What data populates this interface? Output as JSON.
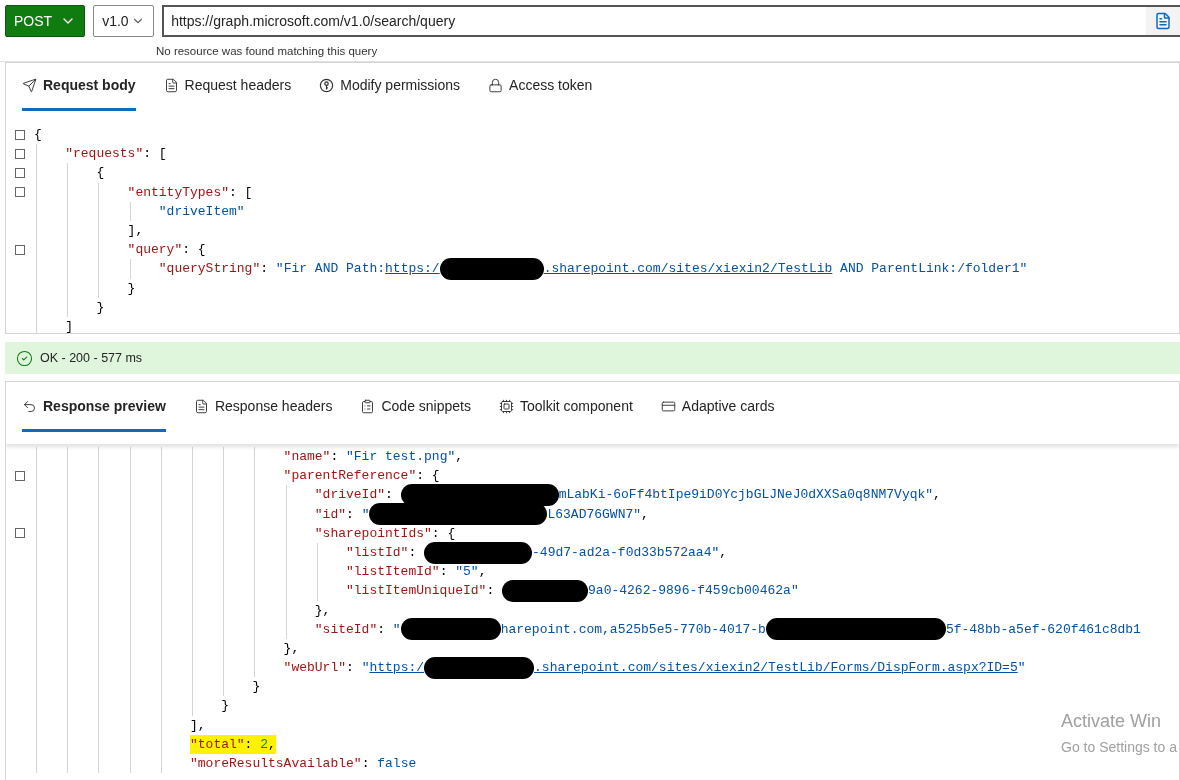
{
  "toolbar": {
    "method": "POST",
    "version": "v1.0",
    "url": "https://graph.microsoft.com/v1.0/search/query",
    "url_hint": "No resource was found matching this query"
  },
  "request_tabs": [
    {
      "label": "Request body",
      "selected": true
    },
    {
      "label": "Request headers",
      "selected": false
    },
    {
      "label": "Modify permissions",
      "selected": false
    },
    {
      "label": "Access token",
      "selected": false
    }
  ],
  "request_body": [
    {
      "foldable": true,
      "tokens": [
        {
          "kind": "punct",
          "text": "{"
        }
      ]
    },
    {
      "foldable": true,
      "tokens": [
        {
          "kind": "key",
          "text": "\"requests\""
        },
        {
          "kind": "punct",
          "text": ": ["
        }
      ]
    },
    {
      "foldable": true,
      "tokens": [
        {
          "kind": "punct",
          "text": "{"
        }
      ]
    },
    {
      "foldable": true,
      "tokens": [
        {
          "kind": "key",
          "text": "\"entityTypes\""
        },
        {
          "kind": "punct",
          "text": ": ["
        }
      ]
    },
    {
      "foldable": false,
      "tokens": [
        {
          "kind": "string",
          "text": "\"driveItem\""
        }
      ]
    },
    {
      "foldable": false,
      "tokens": [
        {
          "kind": "punct",
          "text": "],"
        }
      ]
    },
    {
      "foldable": true,
      "tokens": [
        {
          "kind": "key",
          "text": "\"query\""
        },
        {
          "kind": "punct",
          "text": ": {"
        }
      ]
    },
    {
      "foldable": false,
      "tokens": [
        {
          "kind": "key",
          "text": "\"queryString\""
        },
        {
          "kind": "punct",
          "text": ": "
        },
        {
          "kind": "string",
          "text": "\"Fir AND Path:"
        },
        {
          "kind": "link",
          "text": "https:/"
        },
        {
          "kind": "redaction"
        },
        {
          "kind": "link",
          "text": ".sharepoint.com/sites/xiexin2/TestLib"
        },
        {
          "kind": "string",
          "text": " AND ParentLink:/folder1\""
        }
      ]
    },
    {
      "foldable": false,
      "tokens": [
        {
          "kind": "punct",
          "text": "}"
        }
      ]
    },
    {
      "foldable": false,
      "tokens": [
        {
          "kind": "punct",
          "text": "}"
        }
      ]
    },
    {
      "foldable": false,
      "tokens": [
        {
          "kind": "punct",
          "text": "]"
        }
      ]
    }
  ],
  "status": {
    "text": "OK - 200 - 577 ms"
  },
  "response_tabs": [
    {
      "label": "Response preview",
      "selected": true
    },
    {
      "label": "Response headers",
      "selected": false
    },
    {
      "label": "Code snippets",
      "selected": false
    },
    {
      "label": "Toolkit component",
      "selected": false
    },
    {
      "label": "Adaptive cards",
      "selected": false
    }
  ],
  "response_body": [
    {
      "foldable": false,
      "highlighted": false,
      "tokens": [
        {
          "kind": "key",
          "text": "\"name\""
        },
        {
          "kind": "punct",
          "text": ": "
        },
        {
          "kind": "string",
          "text": "\"Fir test.png\""
        },
        {
          "kind": "punct",
          "text": ","
        }
      ]
    },
    {
      "foldable": true,
      "highlighted": false,
      "tokens": [
        {
          "kind": "key",
          "text": "\"parentReference\""
        },
        {
          "kind": "punct",
          "text": ": {"
        }
      ]
    },
    {
      "foldable": false,
      "highlighted": false,
      "tokens": [
        {
          "kind": "key",
          "text": "\"driveId\""
        },
        {
          "kind": "punct",
          "text": ": "
        },
        {
          "kind": "redaction"
        },
        {
          "kind": "string",
          "text": "mLabKi-6oFf4btIpe9iD0YcjbGLJNeJ0dXXSa0q8NM7Vyqk\""
        },
        {
          "kind": "punct",
          "text": ","
        }
      ]
    },
    {
      "foldable": false,
      "highlighted": false,
      "tokens": [
        {
          "kind": "key",
          "text": "\"id\""
        },
        {
          "kind": "punct",
          "text": ": "
        },
        {
          "kind": "string",
          "text": "\""
        },
        {
          "kind": "redaction"
        },
        {
          "kind": "string",
          "text": "L63AD76GWN7\""
        },
        {
          "kind": "punct",
          "text": ","
        }
      ]
    },
    {
      "foldable": true,
      "highlighted": false,
      "tokens": [
        {
          "kind": "key",
          "text": "\"sharepointIds\""
        },
        {
          "kind": "punct",
          "text": ": {"
        }
      ]
    },
    {
      "foldable": false,
      "highlighted": false,
      "tokens": [
        {
          "kind": "key",
          "text": "\"listId\""
        },
        {
          "kind": "punct",
          "text": ": "
        },
        {
          "kind": "redaction"
        },
        {
          "kind": "string",
          "text": "-49d7-ad2a-f0d33b572aa4\""
        },
        {
          "kind": "punct",
          "text": ","
        }
      ]
    },
    {
      "foldable": false,
      "highlighted": false,
      "tokens": [
        {
          "kind": "key",
          "text": "\"listItemId\""
        },
        {
          "kind": "punct",
          "text": ": "
        },
        {
          "kind": "string",
          "text": "\"5\""
        },
        {
          "kind": "punct",
          "text": ","
        }
      ]
    },
    {
      "foldable": false,
      "highlighted": false,
      "tokens": [
        {
          "kind": "key",
          "text": "\"listItemUniqueId\""
        },
        {
          "kind": "punct",
          "text": ": "
        },
        {
          "kind": "redaction"
        },
        {
          "kind": "string",
          "text": "9a0-4262-9896-f459cb00462a\""
        }
      ]
    },
    {
      "foldable": false,
      "highlighted": false,
      "tokens": [
        {
          "kind": "punct",
          "text": "},"
        }
      ]
    },
    {
      "foldable": false,
      "highlighted": false,
      "tokens": [
        {
          "kind": "key",
          "text": "\"siteId\""
        },
        {
          "kind": "punct",
          "text": ": "
        },
        {
          "kind": "string",
          "text": "\""
        },
        {
          "kind": "redaction"
        },
        {
          "kind": "string",
          "text": "harepoint.com,a525b5e5-770b-4017-b"
        },
        {
          "kind": "redaction"
        },
        {
          "kind": "string",
          "text": "5f-48bb-a5ef-620f461c8db1"
        }
      ]
    },
    {
      "foldable": false,
      "highlighted": false,
      "tokens": [
        {
          "kind": "punct",
          "text": "},"
        }
      ]
    },
    {
      "foldable": false,
      "highlighted": false,
      "tokens": [
        {
          "kind": "key",
          "text": "\"webUrl\""
        },
        {
          "kind": "punct",
          "text": ": "
        },
        {
          "kind": "string",
          "text": "\""
        },
        {
          "kind": "link",
          "text": "https:/"
        },
        {
          "kind": "redaction"
        },
        {
          "kind": "link",
          "text": ".sharepoint.com/sites/xiexin2/TestLib/Forms/DispForm.aspx?ID=5"
        },
        {
          "kind": "string",
          "text": "\""
        }
      ]
    },
    {
      "foldable": false,
      "highlighted": false,
      "tokens": [
        {
          "kind": "punct",
          "text": "}"
        }
      ]
    },
    {
      "foldable": false,
      "highlighted": false,
      "tokens": [
        {
          "kind": "punct",
          "text": "}"
        }
      ]
    },
    {
      "foldable": false,
      "highlighted": false,
      "tokens": [
        {
          "kind": "punct",
          "text": "],"
        }
      ]
    },
    {
      "foldable": false,
      "highlighted": true,
      "tokens": [
        {
          "kind": "key",
          "text": "\"total\""
        },
        {
          "kind": "punct",
          "text": ": "
        },
        {
          "kind": "number",
          "text": "2"
        },
        {
          "kind": "punct",
          "text": ","
        }
      ]
    },
    {
      "foldable": false,
      "highlighted": false,
      "tokens": [
        {
          "kind": "key",
          "text": "\"moreResultsAvailable\""
        },
        {
          "kind": "punct",
          "text": ": "
        },
        {
          "kind": "bool",
          "text": "false"
        }
      ]
    }
  ],
  "activation_notice": {
    "title": "Activate Win",
    "subtitle": "Go to Settings to a"
  }
}
